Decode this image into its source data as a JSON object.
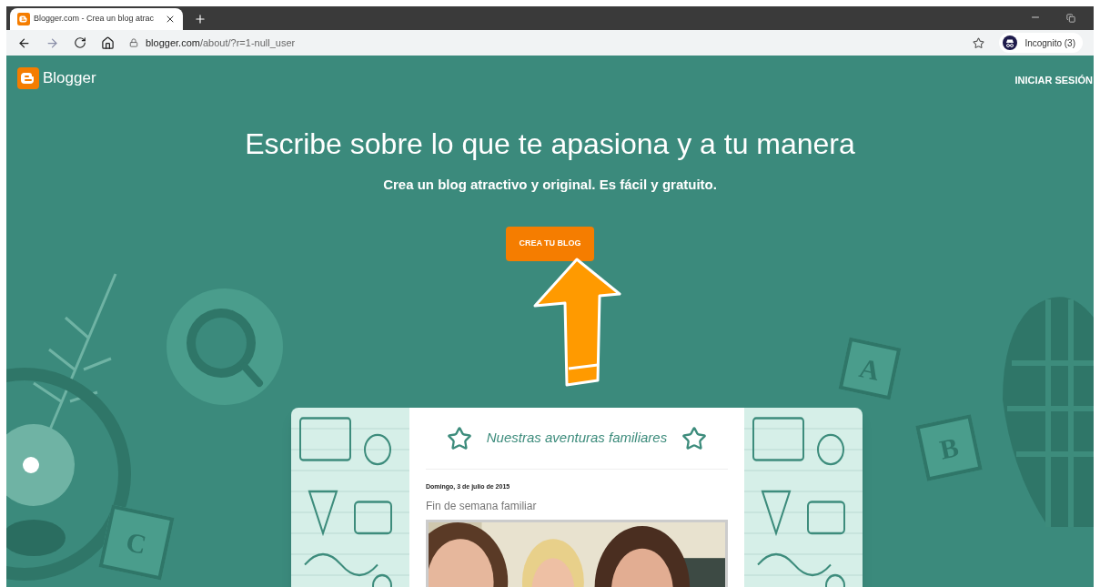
{
  "browser": {
    "tab": {
      "title": "Blogger.com - Crea un blog atrac",
      "selected": true
    },
    "url": {
      "domain": "blogger.com",
      "path": "/about/?r=1-null_user"
    },
    "profile": "Incognito (3)"
  },
  "header": {
    "logo": "Blogger",
    "sign_in": "INICIAR SESIÓN"
  },
  "hero": {
    "title": "Escribe sobre lo que te apasiona y a tu manera",
    "subtitle": "Crea un blog atractivo y original. Es fácil y gratuito.",
    "cta": "CREA TU BLOG"
  },
  "blocks": [
    "A",
    "B",
    "C"
  ],
  "preview": {
    "blog_title": "Nuestras aventuras familiares",
    "date": "Domingo, 3 de julio de 2015",
    "post_title": "Fin de semana familiar"
  }
}
